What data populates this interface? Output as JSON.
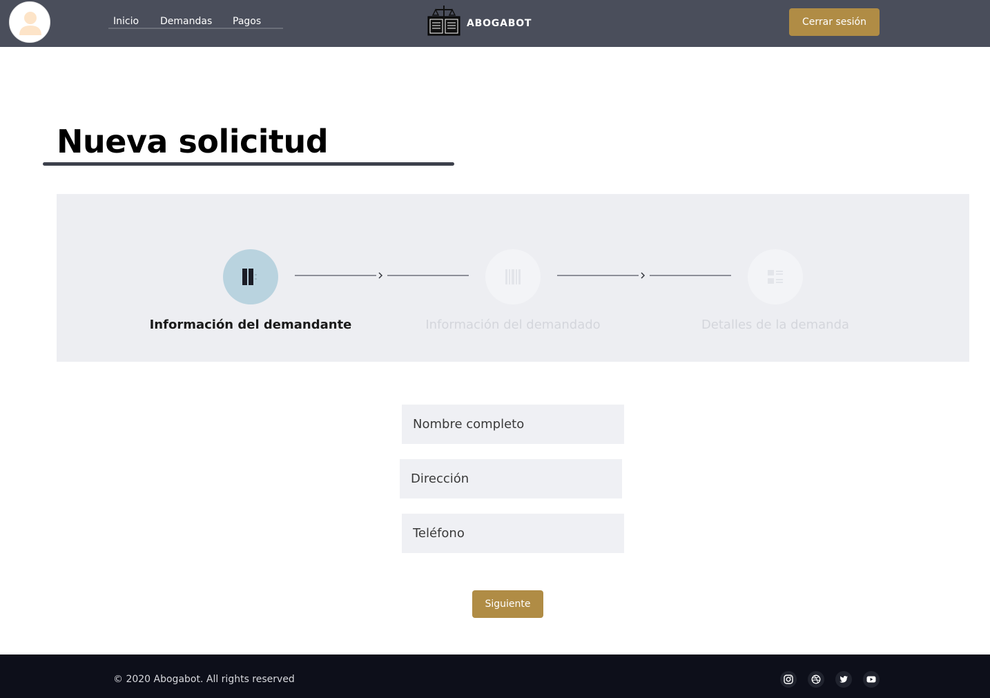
{
  "header": {
    "nav": [
      "Inicio",
      "Demandas",
      "Pagos"
    ],
    "brand": "ABOGABOT",
    "logout_label": "Cerrar sesión"
  },
  "page": {
    "title": "Nueva solicitud"
  },
  "stepper": {
    "steps": [
      {
        "label": "Información del demandante",
        "icon": "columns-icon",
        "state": "active"
      },
      {
        "label": "Información del demandado",
        "icon": "barcode-icon",
        "state": "inactive"
      },
      {
        "label": "Detalles de la demanda",
        "icon": "list-icon",
        "state": "inactive"
      }
    ]
  },
  "form": {
    "name_placeholder": "Nombre completo",
    "address_placeholder": "Dirección",
    "phone_placeholder": "Teléfono",
    "next_label": "Siguiente"
  },
  "footer": {
    "copyright": "© 2020 Abogabot. All rights reserved",
    "social": [
      "instagram-icon",
      "dribbble-icon",
      "twitter-icon",
      "youtube-icon"
    ]
  },
  "colors": {
    "header_bg": "#4a4e5b",
    "accent": "#b08c45",
    "stepper_bg": "#edeef2",
    "active_step": "#b9d3df",
    "footer_bg": "#0d0f1a"
  }
}
